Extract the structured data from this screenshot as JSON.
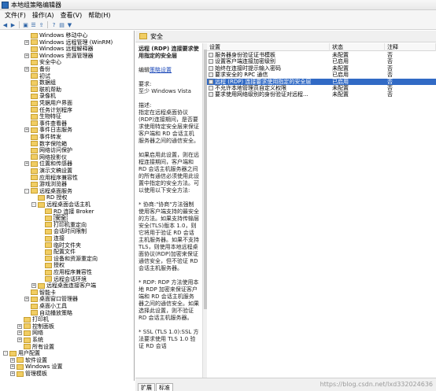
{
  "window": {
    "title": "本地组策略编辑器"
  },
  "menu": [
    "文件(F)",
    "操作(A)",
    "查看(V)",
    "帮助(H)"
  ],
  "toolbar": [
    "back-icon",
    "forward-icon",
    "folder-icon",
    "list-icon",
    "export-icon",
    "help-icon",
    "view-icon",
    "filter-icon"
  ],
  "tree": [
    {
      "label": "Windows 移动中心",
      "indent": 3,
      "toggle": ""
    },
    {
      "label": "Windows 远程管理 (WinRM)",
      "indent": 3,
      "toggle": "+"
    },
    {
      "label": "Windows 远程解释器",
      "indent": 3,
      "toggle": ""
    },
    {
      "label": "Windows 资源管理器",
      "indent": 3,
      "toggle": "+"
    },
    {
      "label": "安全中心",
      "indent": 3,
      "toggle": ""
    },
    {
      "label": "备份",
      "indent": 3,
      "toggle": "+"
    },
    {
      "label": "初试",
      "indent": 3,
      "toggle": ""
    },
    {
      "label": "数据组",
      "indent": 3,
      "toggle": ""
    },
    {
      "label": "联机帮助",
      "indent": 3,
      "toggle": ""
    },
    {
      "label": "录像机",
      "indent": 3,
      "toggle": ""
    },
    {
      "label": "凭据用户界面",
      "indent": 3,
      "toggle": ""
    },
    {
      "label": "任务计划程序",
      "indent": 3,
      "toggle": ""
    },
    {
      "label": "生物特征",
      "indent": 3,
      "toggle": ""
    },
    {
      "label": "事件查看器",
      "indent": 3,
      "toggle": ""
    },
    {
      "label": "事件日志服务",
      "indent": 3,
      "toggle": "+"
    },
    {
      "label": "事件转发",
      "indent": 3,
      "toggle": ""
    },
    {
      "label": "数字保险箱",
      "indent": 3,
      "toggle": ""
    },
    {
      "label": "网络访问保护",
      "indent": 3,
      "toggle": ""
    },
    {
      "label": "网络投影仪",
      "indent": 3,
      "toggle": ""
    },
    {
      "label": "位置和传感器",
      "indent": 3,
      "toggle": "+"
    },
    {
      "label": "演示文稿设置",
      "indent": 3,
      "toggle": ""
    },
    {
      "label": "应用程序兼容性",
      "indent": 3,
      "toggle": ""
    },
    {
      "label": "游戏浏览器",
      "indent": 3,
      "toggle": ""
    },
    {
      "label": "远程桌面服务",
      "indent": 3,
      "toggle": "-"
    },
    {
      "label": "RD 授权",
      "indent": 4,
      "toggle": ""
    },
    {
      "label": "远程桌面会话主机",
      "indent": 4,
      "toggle": "-"
    },
    {
      "label": "RD 连接 Broker",
      "indent": 5,
      "toggle": ""
    },
    {
      "label": "安全",
      "indent": 5,
      "toggle": "",
      "selected": true
    },
    {
      "label": "打印机重定向",
      "indent": 5,
      "toggle": ""
    },
    {
      "label": "会话时间限制",
      "indent": 5,
      "toggle": ""
    },
    {
      "label": "连接",
      "indent": 5,
      "toggle": ""
    },
    {
      "label": "临时文件夹",
      "indent": 5,
      "toggle": ""
    },
    {
      "label": "配置文件",
      "indent": 5,
      "toggle": ""
    },
    {
      "label": "设备和资源重定向",
      "indent": 5,
      "toggle": ""
    },
    {
      "label": "授权",
      "indent": 5,
      "toggle": ""
    },
    {
      "label": "应用程序兼容性",
      "indent": 5,
      "toggle": ""
    },
    {
      "label": "远程会话环境",
      "indent": 5,
      "toggle": ""
    },
    {
      "label": "远程桌面连接客户端",
      "indent": 4,
      "toggle": "+"
    },
    {
      "label": "智能卡",
      "indent": 3,
      "toggle": ""
    },
    {
      "label": "桌面窗口管理器",
      "indent": 3,
      "toggle": "+"
    },
    {
      "label": "桌面小工具",
      "indent": 3,
      "toggle": ""
    },
    {
      "label": "自动播放策略",
      "indent": 3,
      "toggle": ""
    },
    {
      "label": "打印机",
      "indent": 2,
      "toggle": ""
    },
    {
      "label": "控制面板",
      "indent": 2,
      "toggle": "+"
    },
    {
      "label": "网络",
      "indent": 2,
      "toggle": "+"
    },
    {
      "label": "系统",
      "indent": 2,
      "toggle": "+"
    },
    {
      "label": "所有设置",
      "indent": 2,
      "toggle": ""
    },
    {
      "label": "用户配置",
      "indent": 0,
      "toggle": "-"
    },
    {
      "label": "软件设置",
      "indent": 1,
      "toggle": "+"
    },
    {
      "label": "Windows 设置",
      "indent": 1,
      "toggle": "+"
    },
    {
      "label": "管理模板",
      "indent": 1,
      "toggle": "+"
    }
  ],
  "right_header": {
    "title": "安全"
  },
  "description": {
    "title": "远程 (RDP) 连接要求使用指定的安全层",
    "edit_prefix": "编辑",
    "edit_link": "策略设置",
    "requirements_label": "要求:",
    "requirements_value": "至少 Windows Vista",
    "desc_label": "描述:",
    "paragraphs": [
      "指定在远程桌面协议(RDP)连接期间，是否要求使用特定安全层来保证客户端和 RD 会话主机服务器之间的通信安全。",
      "如果启用此设置，则在远程连接期间，客户端和 RD 会话主机服务器之间的所有通信必须使用此设置中指定的安全方法。可以使用以下安全方法:",
      "* 协商:\"协商\"方法强制使用客户端支持的最安全的方法。如果支持传输层安全(TLS)版本 1.0，则它将用于验证 RD 会话主机服务器。如果不支持 TLS，则使用本地远程桌面协议(RDP)加密来保证通信安全，但不验证 RD 会话主机服务器。",
      "* RDP: RDP 方法使用本地 RDP 加密来保证客户端和 RD 会话主机服务器之间的通信安全。如果选择此设置，则不验证 RD 会话主机服务器。",
      "* SSL (TLS 1.0):SSL 方法要求使用 TLS 1.0 验证 RD 会话"
    ]
  },
  "list": {
    "columns": [
      "设置",
      "状态",
      "注释"
    ],
    "rows": [
      {
        "setting": "服务器身份验证证书模板",
        "state": "未配置",
        "comment": "否"
      },
      {
        "setting": "设置客户端连接加密级别",
        "state": "已启用",
        "comment": "否"
      },
      {
        "setting": "始终在连接时提示输入密码",
        "state": "未配置",
        "comment": "否"
      },
      {
        "setting": "要求安全的 RPC 通信",
        "state": "已启用",
        "comment": "否"
      },
      {
        "setting": "远程 (RDP) 连接要求使用指定的安全层",
        "state": "已启用",
        "comment": "否",
        "selected": true
      },
      {
        "setting": "不允许本地管理员自定义权限",
        "state": "未配置",
        "comment": "否"
      },
      {
        "setting": "要求使用网络级别的身份验证对远程...",
        "state": "未配置",
        "comment": "否"
      }
    ]
  },
  "tabs": [
    "扩展",
    "标准"
  ],
  "watermark": "https://blog.csdn.net/lxd332024636"
}
